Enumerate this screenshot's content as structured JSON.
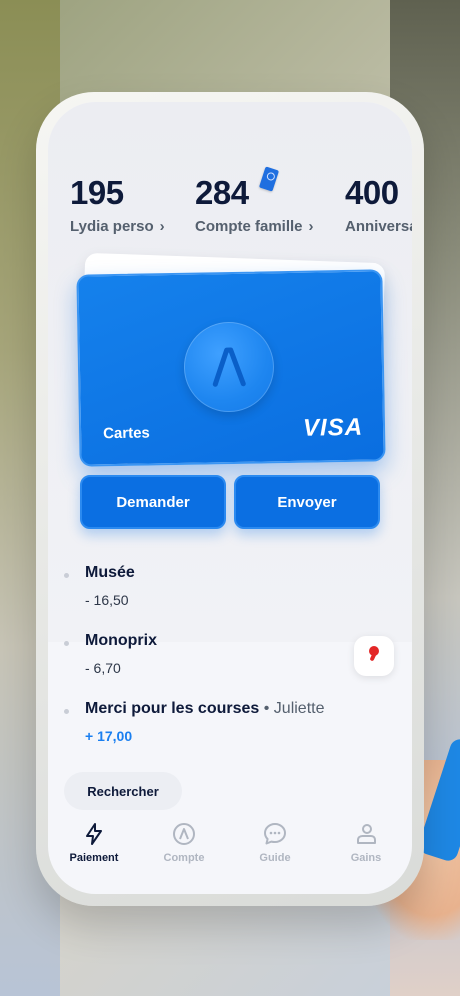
{
  "balances": [
    {
      "amount": "195",
      "label": "Lydia perso"
    },
    {
      "amount": "284",
      "label": "Compte famille"
    },
    {
      "amount": "400",
      "label": "Anniversaire"
    }
  ],
  "card": {
    "name": "Cartes",
    "brand": "VISA"
  },
  "actions": {
    "request": "Demander",
    "send": "Envoyer"
  },
  "transactions": [
    {
      "title": "Musée",
      "subtitle": "",
      "amount": "- 16,50"
    },
    {
      "title": "Monoprix",
      "subtitle": "",
      "amount": "- 6,70"
    },
    {
      "title": "Merci pour les courses",
      "subtitle": " • Juliette",
      "amount": "+ 17,00"
    }
  ],
  "search": {
    "label": "Rechercher"
  },
  "tabs": [
    {
      "label": "Paiement",
      "icon": "lightning-icon"
    },
    {
      "label": "Compte",
      "icon": "lydia-logo-icon"
    },
    {
      "label": "Guide",
      "icon": "chat-bubble-icon"
    },
    {
      "label": "Gains",
      "icon": "person-icon"
    }
  ],
  "colors": {
    "accent": "#0b6fe2",
    "text": "#0e1a3a",
    "positive": "#1a7ff0"
  }
}
